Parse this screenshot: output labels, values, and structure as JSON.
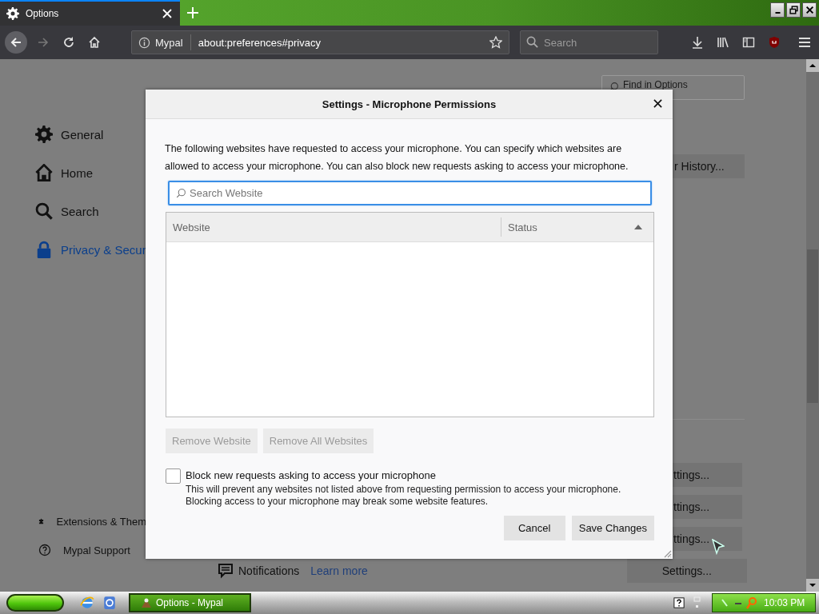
{
  "tab": {
    "title": "Options",
    "selected": true
  },
  "toolbar": {
    "identity": "Mypal",
    "url": "about:preferences#privacy",
    "search_placeholder": "Search"
  },
  "find_field": {
    "placeholder": "Find in Options"
  },
  "sidebar": {
    "items": [
      {
        "label": "General",
        "kind": "gear",
        "selected": false
      },
      {
        "label": "Home",
        "kind": "home",
        "selected": false
      },
      {
        "label": "Search",
        "kind": "search",
        "selected": false
      },
      {
        "label": "Privacy & Secur",
        "kind": "lock",
        "selected": true
      }
    ],
    "footer_items": [
      {
        "label": "Extensions & Them",
        "kind": "puzzle"
      },
      {
        "label": "Mypal Support",
        "kind": "help"
      }
    ]
  },
  "history_button": "r History...",
  "settings_buttons": [
    "ttings...",
    "ttings...",
    "ttings..."
  ],
  "notifications": {
    "label": "Notifications",
    "link": "Learn more",
    "button": "Settings..."
  },
  "dialog": {
    "title": "Settings - Microphone Permissions",
    "description": "The following websites have requested to access your microphone. You can specify which websites are allowed to access your microphone. You can also block new requests asking to access your microphone.",
    "search_placeholder": "Search Website",
    "columns": [
      {
        "label": "Website",
        "sorted": false
      },
      {
        "label": "Status",
        "sorted": true
      }
    ],
    "buttons": [
      {
        "label": "Remove Website",
        "disabled": true
      },
      {
        "label": "Remove All Websites",
        "disabled": true
      }
    ],
    "block": {
      "label": "Block new requests asking to access your microphone",
      "checked": false,
      "note": "This will prevent any websites not listed above from requesting permission to access your microphone. Blocking access to your microphone may break some website features."
    },
    "footer_buttons": [
      "Cancel",
      "Save Changes"
    ]
  },
  "taskbar": {
    "task": {
      "label": "Options - Mypal",
      "selected": true
    },
    "clock": "10:03 PM"
  }
}
